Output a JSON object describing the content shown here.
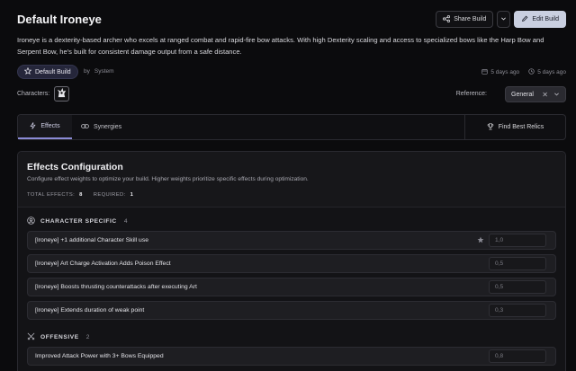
{
  "build": {
    "title": "Default Ironeye",
    "description": "Ironeye is a dexterity-based archer who excels at ranged combat and rapid-fire bow attacks. With high Dexterity scaling and access to specialized bows like the Harp Bow and Serpent Bow, he's built for consistent damage output from a safe distance.",
    "badge": "Default Build",
    "by_label": "by",
    "author": "System",
    "created": "5 days ago",
    "updated": "5 days ago"
  },
  "header_actions": {
    "share": "Share Build",
    "edit": "Edit Build"
  },
  "characters": {
    "label": "Characters:",
    "avatar_icon": "ironeye-portrait-icon"
  },
  "reference": {
    "label": "Reference:",
    "value": "General"
  },
  "tabs": {
    "effects": "Effects",
    "synergies": "Synergies",
    "find_relics": "Find Best Relics"
  },
  "panel": {
    "title": "Effects Configuration",
    "subtitle": "Configure effect weights to optimize your build. Higher weights prioritize specific effects during optimization.",
    "total_label": "TOTAL EFFECTS:",
    "total_value": "8",
    "required_label": "REQUIRED:",
    "required_value": "1"
  },
  "sections": [
    {
      "name": "CHARACTER SPECIFIC",
      "count": "4",
      "icon": "person-circle-icon",
      "effects": [
        {
          "label": "[Ironeye] +1 additional Character Skill use",
          "weight": "1,0",
          "starred": true
        },
        {
          "label": "[Ironeye] Art Charge Activation Adds Poison Effect",
          "weight": "0,5"
        },
        {
          "label": "[Ironeye] Boosts thrusting counterattacks after executing Art",
          "weight": "0,5"
        },
        {
          "label": "[Ironeye] Extends duration of weak point",
          "weight": "0,3"
        }
      ]
    },
    {
      "name": "OFFENSIVE",
      "count": "2",
      "icon": "crossed-swords-icon",
      "effects": [
        {
          "label": "Improved Attack Power with 3+ Bows Equipped",
          "weight": "0,8"
        }
      ]
    }
  ],
  "colors": {
    "background": "#0b0b0d",
    "accent": "#8b8bd6",
    "primary_button": "#c9cfe0"
  }
}
